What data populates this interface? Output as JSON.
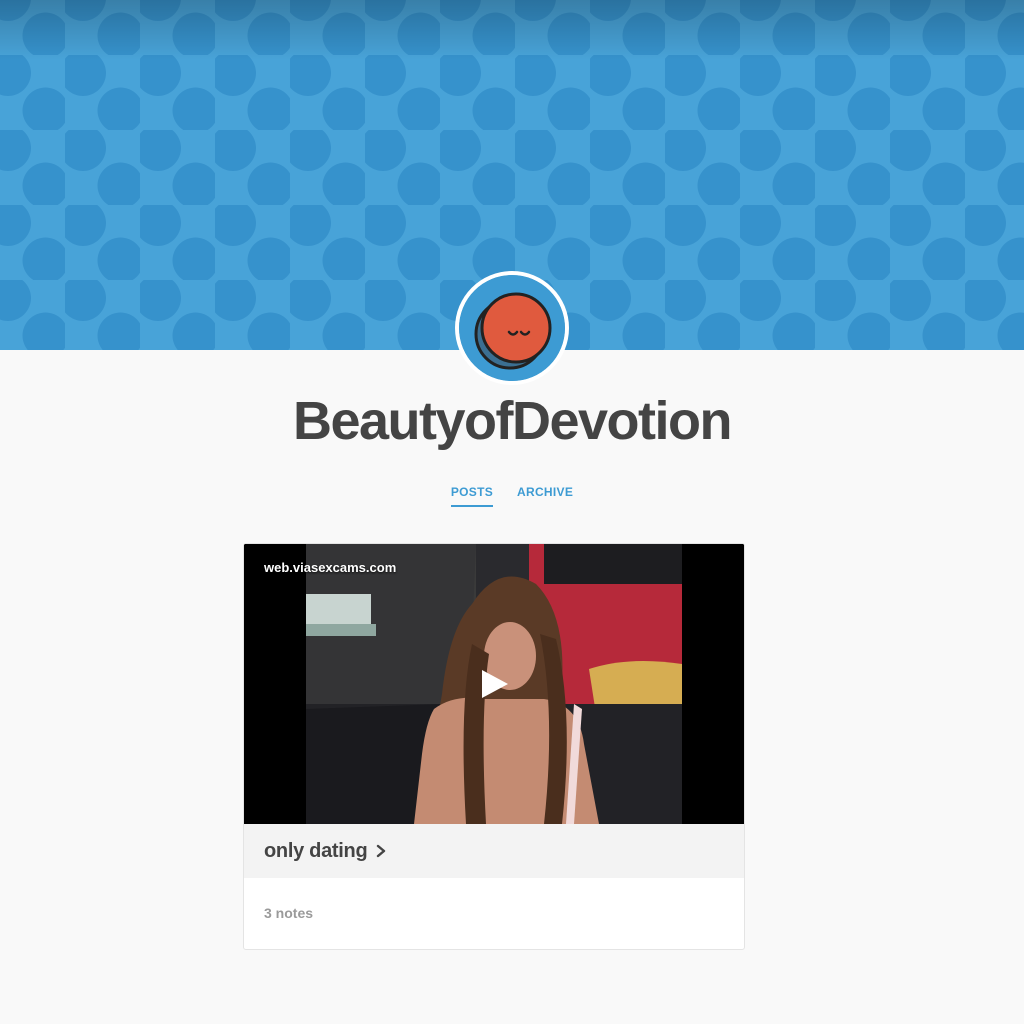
{
  "blog": {
    "title": "BeautyofDevotion"
  },
  "nav": {
    "posts_label": "POSTS",
    "archive_label": "ARCHIVE"
  },
  "post": {
    "video_watermark": "web.viasexcams.com",
    "caption": "only dating",
    "notes": "3 notes"
  },
  "colors": {
    "accent": "#3d9bd3",
    "header_dot": "#3692cc",
    "avatar_face": "#e05a3e",
    "title_text": "#444444"
  },
  "icons": {
    "avatar": "sleeping-face-icon",
    "play": "play-icon",
    "chevron": "chevron-right-icon"
  }
}
